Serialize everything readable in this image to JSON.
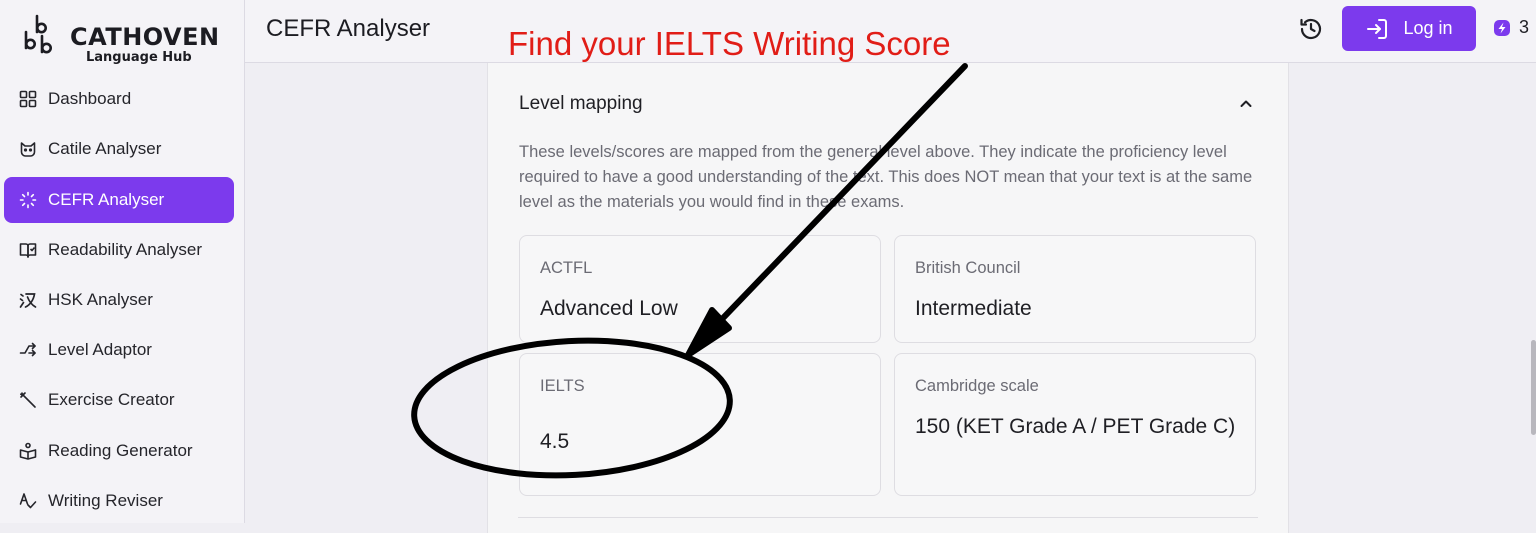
{
  "app": {
    "brand": "CATHOVEN",
    "brand_sub": "Language Hub"
  },
  "sidebar": {
    "items": [
      {
        "label": "Dashboard",
        "icon": "grid-icon"
      },
      {
        "label": "Catile Analyser",
        "icon": "cat-icon"
      },
      {
        "label": "CEFR Analyser",
        "icon": "loader-icon",
        "active": true
      },
      {
        "label": "Readability Analyser",
        "icon": "book-icon"
      },
      {
        "label": "HSK Analyser",
        "icon": "chinese-char-icon"
      },
      {
        "label": "Level Adaptor",
        "icon": "shuffle-icon"
      },
      {
        "label": "Exercise Creator",
        "icon": "wand-icon"
      },
      {
        "label": "Reading Generator",
        "icon": "reader-icon"
      },
      {
        "label": "Writing Reviser",
        "icon": "spell-check-icon"
      }
    ]
  },
  "header": {
    "title": "CEFR Analyser",
    "login_label": "Log in",
    "credits": "3"
  },
  "annotation": {
    "text": "Find your IELTS Writing Score",
    "color": "#e11d17"
  },
  "level_mapping": {
    "title": "Level mapping",
    "description": "These levels/scores are mapped from the general level above. They indicate the proficiency level required to have a good understanding of the text. This does NOT mean that your text is at the same level as the materials you would find in these exams.",
    "tiles": [
      {
        "label": "ACTFL",
        "value": "Advanced Low"
      },
      {
        "label": "British Council",
        "value": "Intermediate"
      },
      {
        "label": "IELTS",
        "value": "4.5"
      },
      {
        "label": "Cambridge scale",
        "value": "150 (KET Grade A / PET Grade C)"
      }
    ]
  },
  "colors": {
    "accent": "#7c3aed",
    "background": "#efeef3"
  }
}
